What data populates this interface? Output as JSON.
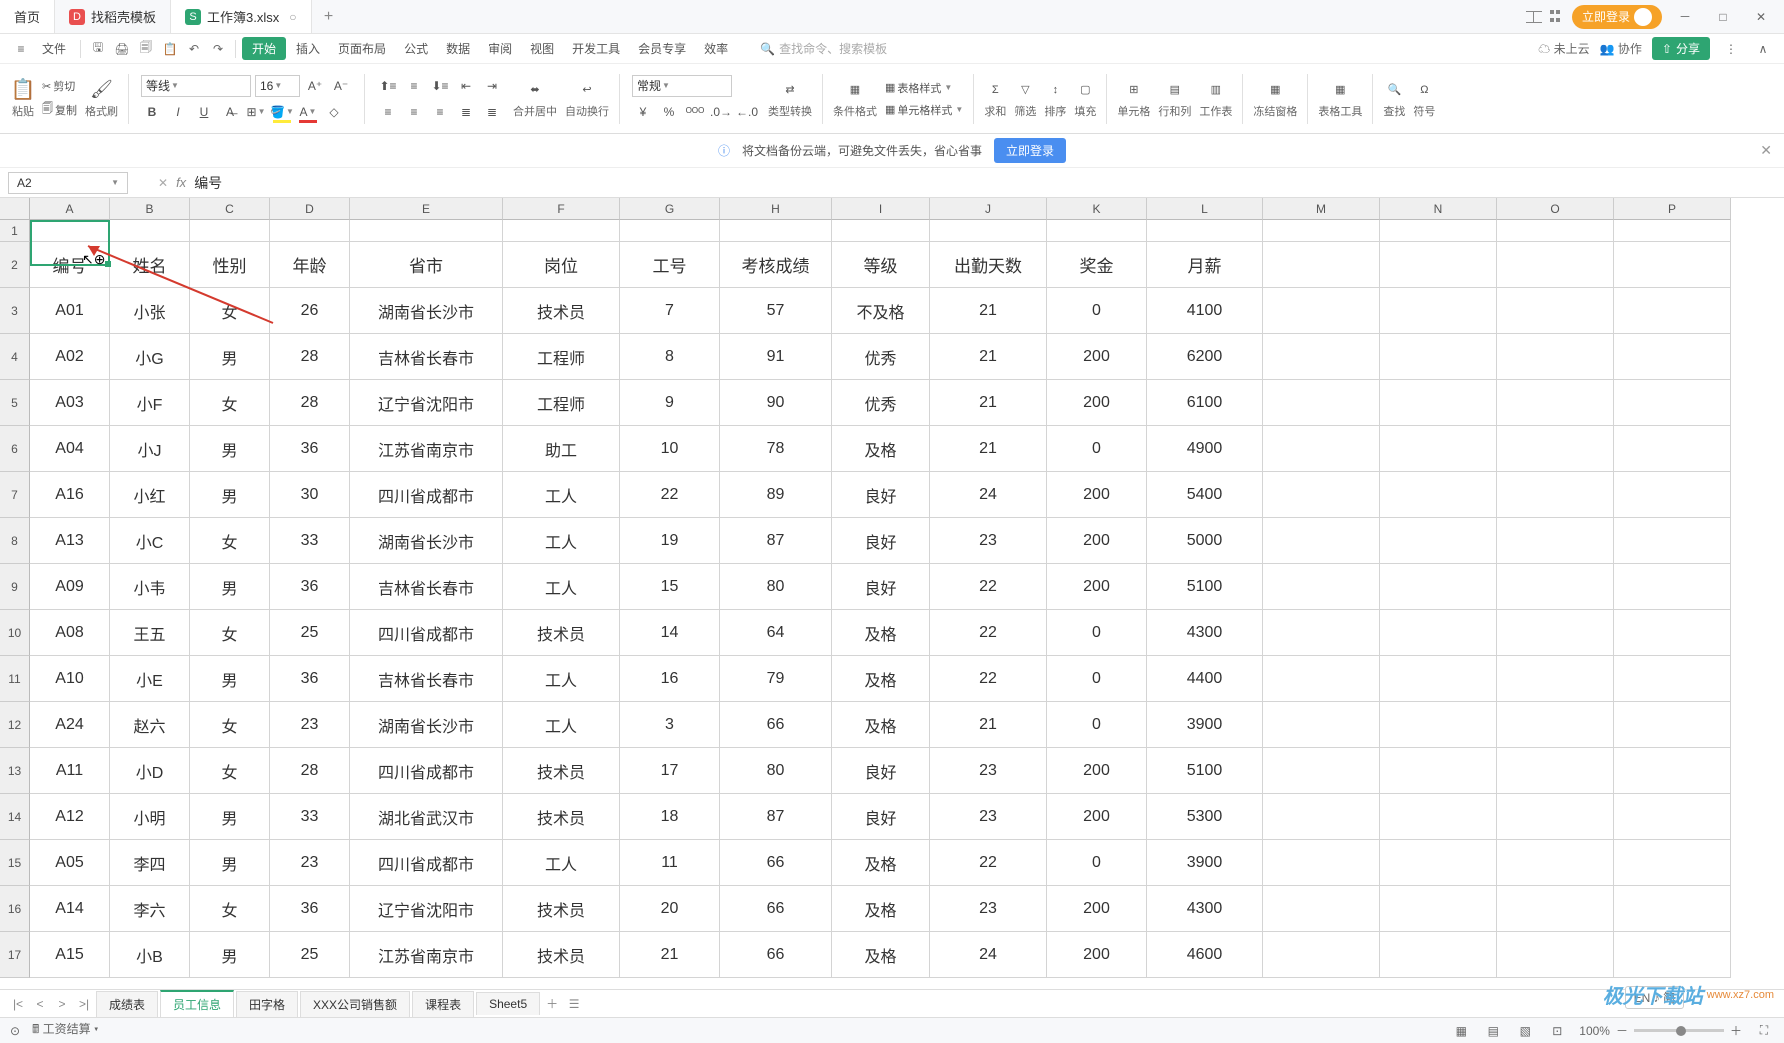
{
  "title_tabs": {
    "home": "首页",
    "template": "找稻壳模板",
    "file": "工作簿3.xlsx",
    "plus": "+"
  },
  "login_button": "立即登录",
  "menu": {
    "file": "文件",
    "items": [
      "开始",
      "插入",
      "页面布局",
      "公式",
      "数据",
      "审阅",
      "视图",
      "开发工具",
      "会员专享",
      "效率"
    ],
    "active_index": 0,
    "search_placeholder": "查找命令、搜索模板",
    "cloud": "未上云",
    "coop": "协作",
    "share": "分享"
  },
  "ribbon": {
    "paste": "粘贴",
    "cut": "剪切",
    "copy": "复制",
    "format_painter": "格式刷",
    "font_name": "等线",
    "font_size": "16",
    "merge_center": "合并居中",
    "wrap": "自动换行",
    "number_format": "常规",
    "type_convert": "类型转换",
    "cond_fmt": "条件格式",
    "table_style": "表格样式",
    "cell_style": "单元格样式",
    "sum": "求和",
    "filter": "筛选",
    "sort": "排序",
    "fill": "填充",
    "cell": "单元格",
    "rowcol": "行和列",
    "worksheet": "工作表",
    "freeze": "冻结窗格",
    "tabletool": "表格工具",
    "find": "查找",
    "symbol": "符号"
  },
  "banner": {
    "text": "将文档备份云端，可避免文件丢失，省心省事",
    "button": "立即登录"
  },
  "namebox": "A2",
  "formula_value": "编号",
  "columns": [
    "A",
    "B",
    "C",
    "D",
    "E",
    "F",
    "G",
    "H",
    "I",
    "J",
    "K",
    "L",
    "M",
    "N",
    "O",
    "P"
  ],
  "headers": [
    "编号",
    "姓名",
    "性别",
    "年龄",
    "省市",
    "岗位",
    "工号",
    "考核成绩",
    "等级",
    "出勤天数",
    "奖金",
    "月薪"
  ],
  "rows": [
    [
      "A01",
      "小张",
      "女",
      "26",
      "湖南省长沙市",
      "技术员",
      "7",
      "57",
      "不及格",
      "21",
      "0",
      "4100"
    ],
    [
      "A02",
      "小G",
      "男",
      "28",
      "吉林省长春市",
      "工程师",
      "8",
      "91",
      "优秀",
      "21",
      "200",
      "6200"
    ],
    [
      "A03",
      "小F",
      "女",
      "28",
      "辽宁省沈阳市",
      "工程师",
      "9",
      "90",
      "优秀",
      "21",
      "200",
      "6100"
    ],
    [
      "A04",
      "小J",
      "男",
      "36",
      "江苏省南京市",
      "助工",
      "10",
      "78",
      "及格",
      "21",
      "0",
      "4900"
    ],
    [
      "A16",
      "小红",
      "男",
      "30",
      "四川省成都市",
      "工人",
      "22",
      "89",
      "良好",
      "24",
      "200",
      "5400"
    ],
    [
      "A13",
      "小C",
      "女",
      "33",
      "湖南省长沙市",
      "工人",
      "19",
      "87",
      "良好",
      "23",
      "200",
      "5000"
    ],
    [
      "A09",
      "小韦",
      "男",
      "36",
      "吉林省长春市",
      "工人",
      "15",
      "80",
      "良好",
      "22",
      "200",
      "5100"
    ],
    [
      "A08",
      "王五",
      "女",
      "25",
      "四川省成都市",
      "技术员",
      "14",
      "64",
      "及格",
      "22",
      "0",
      "4300"
    ],
    [
      "A10",
      "小E",
      "男",
      "36",
      "吉林省长春市",
      "工人",
      "16",
      "79",
      "及格",
      "22",
      "0",
      "4400"
    ],
    [
      "A24",
      "赵六",
      "女",
      "23",
      "湖南省长沙市",
      "工人",
      "3",
      "66",
      "及格",
      "21",
      "0",
      "3900"
    ],
    [
      "A11",
      "小D",
      "女",
      "28",
      "四川省成都市",
      "技术员",
      "17",
      "80",
      "良好",
      "23",
      "200",
      "5100"
    ],
    [
      "A12",
      "小明",
      "男",
      "33",
      "湖北省武汉市",
      "技术员",
      "18",
      "87",
      "良好",
      "23",
      "200",
      "5300"
    ],
    [
      "A05",
      "李四",
      "男",
      "23",
      "四川省成都市",
      "工人",
      "11",
      "66",
      "及格",
      "22",
      "0",
      "3900"
    ],
    [
      "A14",
      "李六",
      "女",
      "36",
      "辽宁省沈阳市",
      "技术员",
      "20",
      "66",
      "及格",
      "23",
      "200",
      "4300"
    ],
    [
      "A15",
      "小B",
      "男",
      "25",
      "江苏省南京市",
      "技术员",
      "21",
      "66",
      "及格",
      "24",
      "200",
      "4600"
    ]
  ],
  "sheets": [
    "成绩表",
    "员工信息",
    "田字格",
    "XXX公司销售额",
    "课程表",
    "Sheet5"
  ],
  "active_sheet": 1,
  "ime": "EN ♪ 简",
  "status": {
    "calc": "工资结算",
    "zoom": "100%"
  },
  "watermark": {
    "brand": "极光下载站",
    "url": "www.xz7.com"
  }
}
